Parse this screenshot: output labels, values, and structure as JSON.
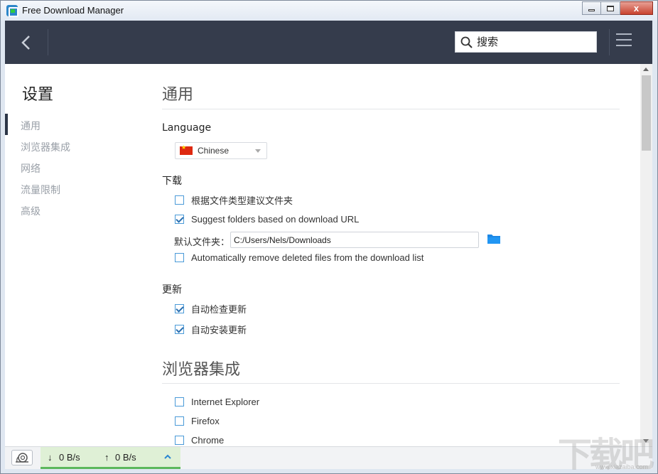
{
  "window": {
    "title": "Free Download Manager",
    "controls": {
      "minimize": "",
      "maximize": "",
      "close": "x"
    }
  },
  "header": {
    "back_icon": "chevron-left-icon",
    "search": {
      "value": "",
      "placeholder": "搜索",
      "icon": "search-icon"
    },
    "menu_icon": "hamburger-menu-icon"
  },
  "sidebar": {
    "title": "设置",
    "active_index": 0,
    "items": [
      {
        "label": "通用"
      },
      {
        "label": "浏览器集成"
      },
      {
        "label": "网络"
      },
      {
        "label": "流量限制"
      },
      {
        "label": "高级"
      }
    ]
  },
  "general": {
    "title": "通用",
    "language": {
      "label": "Language",
      "selected": "Chinese",
      "flag": "china-flag-icon"
    },
    "download": {
      "label": "下载",
      "options": [
        {
          "label": "根据文件类型建议文件夹",
          "checked": false
        },
        {
          "label": "Suggest folders based on download URL",
          "checked": true
        }
      ],
      "default_folder": {
        "label": "默认文件夹：",
        "value": "C:/Users/Nels/Downloads"
      },
      "auto_remove": {
        "label": "Automatically remove deleted files from the download list",
        "checked": false
      }
    },
    "update": {
      "label": "更新",
      "options": [
        {
          "label": "自动检查更新",
          "checked": true
        },
        {
          "label": "自动安装更新",
          "checked": true
        }
      ]
    }
  },
  "browser_integration": {
    "title": "浏览器集成",
    "browsers": [
      {
        "label": "Internet Explorer",
        "checked": false
      },
      {
        "label": "Firefox",
        "checked": false
      },
      {
        "label": "Chrome",
        "checked": false
      }
    ]
  },
  "statusbar": {
    "snail_icon": "snail-icon",
    "download_arrow": "↓",
    "download_speed": "0 B/s",
    "upload_arrow": "↑",
    "upload_speed": "0 B/s",
    "expand_icon": "chevron-up-icon"
  },
  "watermark": {
    "text": "下载吧",
    "sub": "www.xiazaiba.com"
  },
  "colors": {
    "header_bg": "#353c4c",
    "accent_blue": "#2a86d1",
    "speed_panel_bg": "#dff0d6",
    "speed_panel_border": "#5cb85c"
  }
}
